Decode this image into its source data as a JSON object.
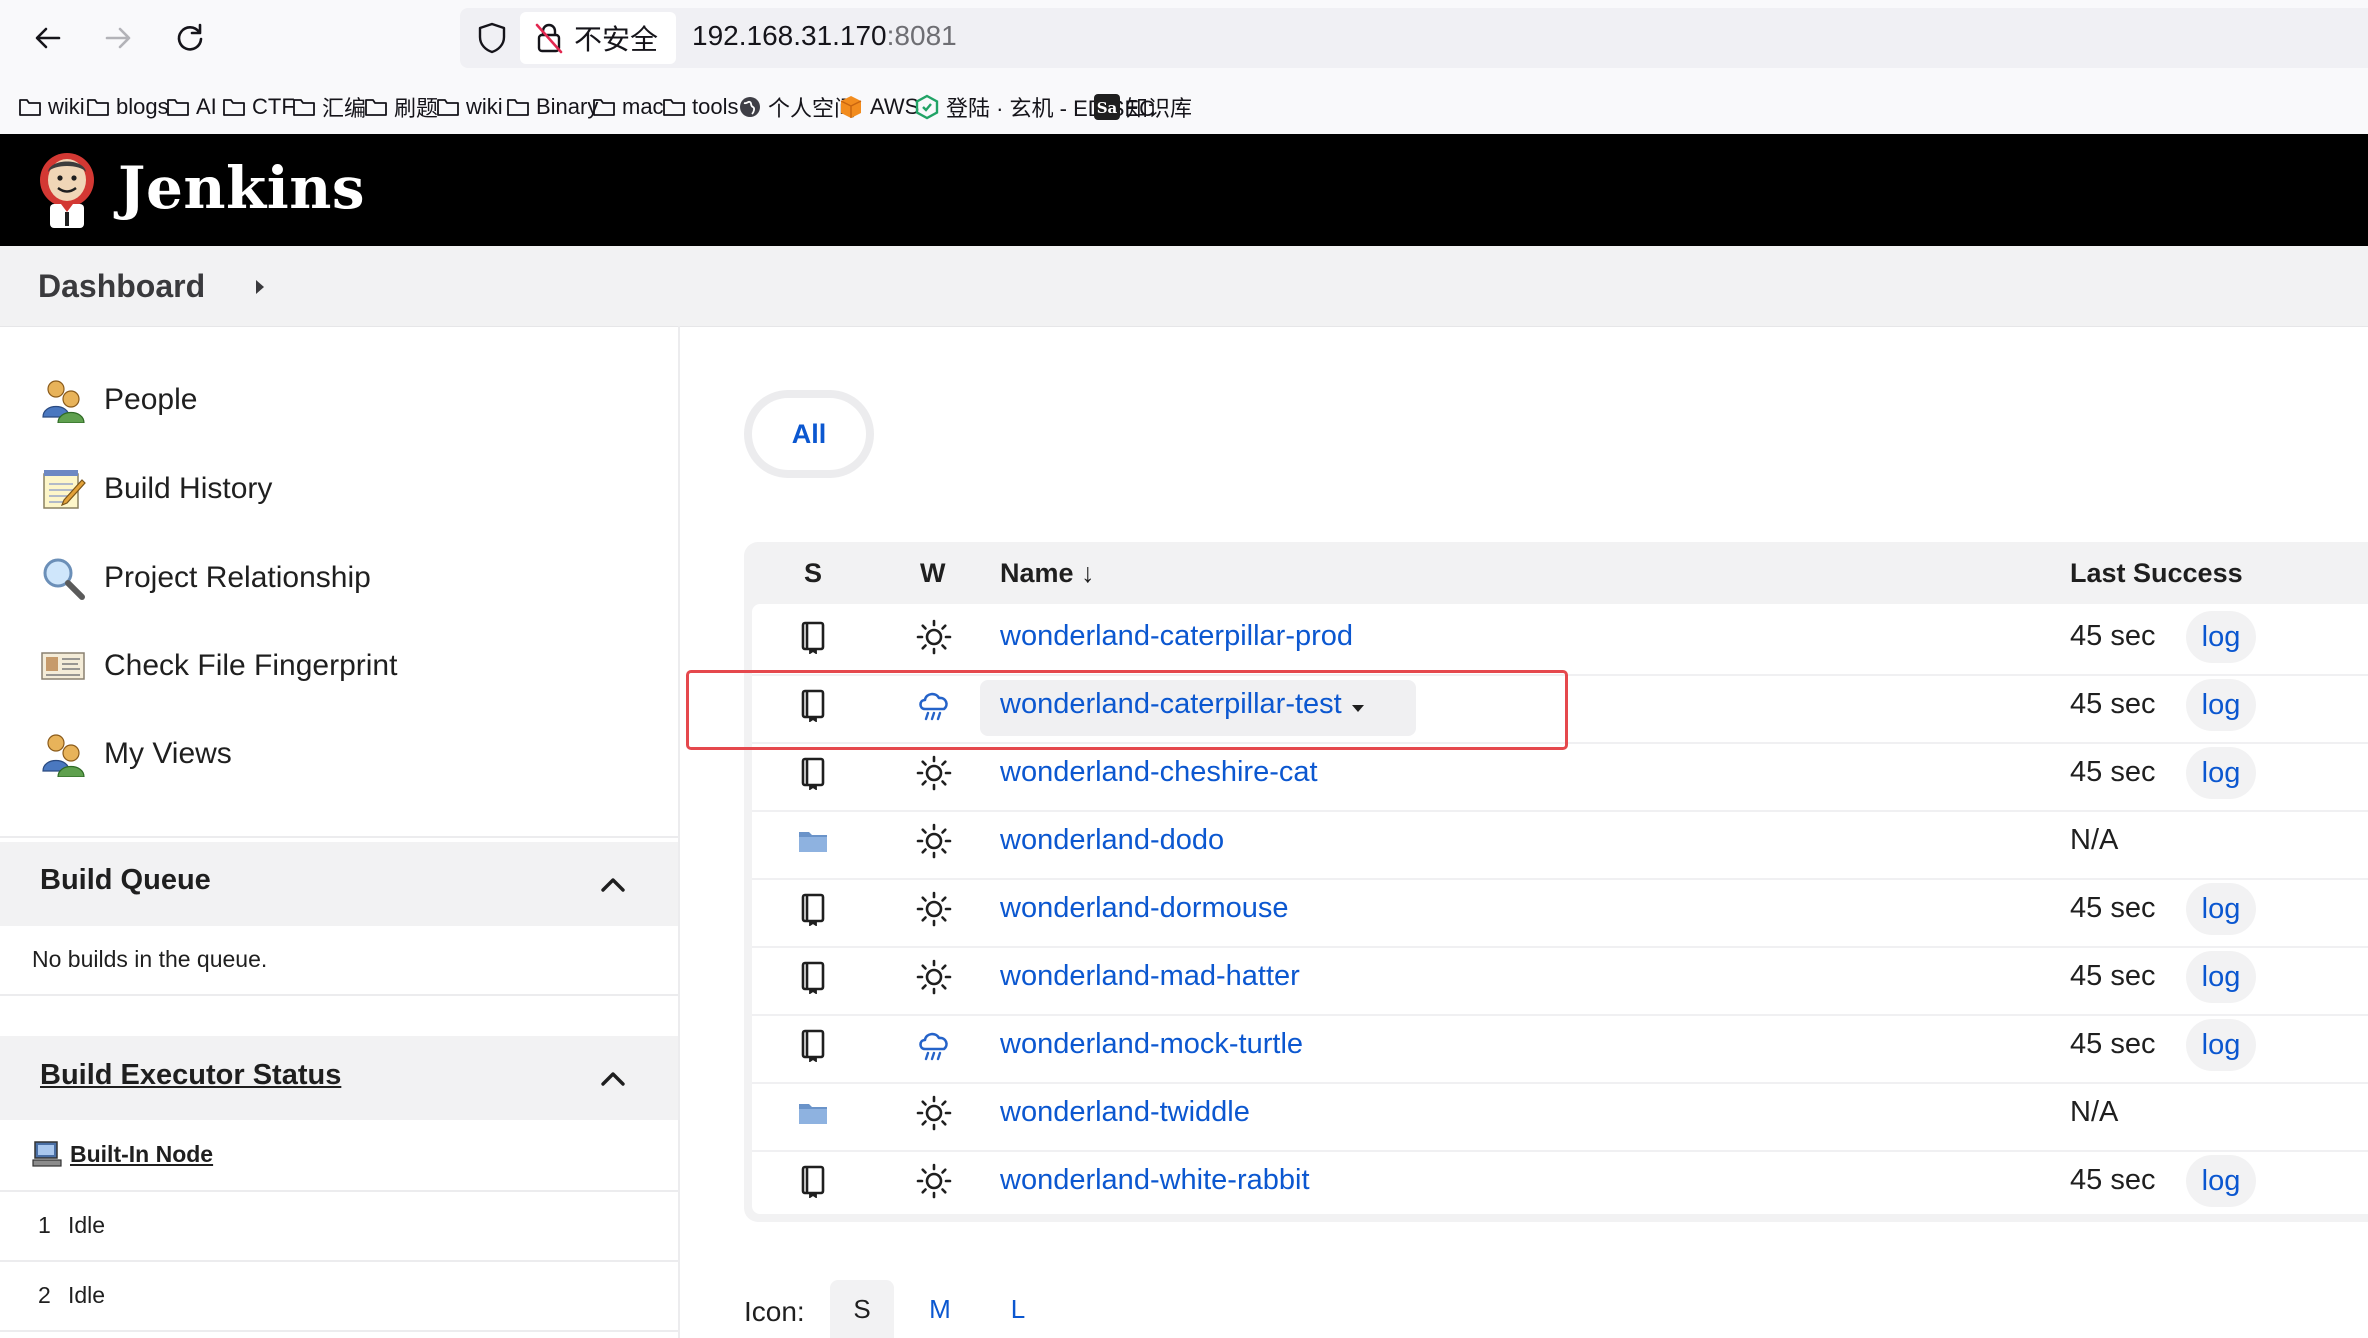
{
  "browser": {
    "insecure_label": "不安全",
    "url_host": "192.168.31.170",
    "url_port": ":8081",
    "bookmarks": [
      {
        "label": "wiki",
        "icon": "folder-icon"
      },
      {
        "label": "blogs",
        "icon": "folder-icon"
      },
      {
        "label": "AI",
        "icon": "folder-icon"
      },
      {
        "label": "CTF",
        "icon": "folder-icon"
      },
      {
        "label": "汇编",
        "icon": "folder-icon"
      },
      {
        "label": "刷题",
        "icon": "folder-icon"
      },
      {
        "label": "wiki",
        "icon": "folder-icon"
      },
      {
        "label": "Binary",
        "icon": "folder-icon"
      },
      {
        "label": "mac",
        "icon": "folder-icon"
      },
      {
        "label": "tools",
        "icon": "folder-icon"
      },
      {
        "label": "个人空间",
        "icon": "globe-icon"
      },
      {
        "label": "AWS",
        "icon": "aws-cube-icon"
      },
      {
        "label": "登陆 · 玄机 - EDISEC",
        "icon": "hexagon-logo-icon"
      },
      {
        "label": "知识库",
        "icon": "sa-logo-icon"
      }
    ]
  },
  "header": {
    "title": "Jenkins"
  },
  "breadcrumb": {
    "dashboard": "Dashboard"
  },
  "sidebar": {
    "items": [
      {
        "label": "People",
        "icon": "people-icon"
      },
      {
        "label": "Build History",
        "icon": "notepad-icon"
      },
      {
        "label": "Project Relationship",
        "icon": "magnifier-icon"
      },
      {
        "label": "Check File Fingerprint",
        "icon": "fingerprint-card-icon"
      },
      {
        "label": "My Views",
        "icon": "people-icon"
      }
    ],
    "build_queue": {
      "title": "Build Queue",
      "empty_text": "No builds in the queue."
    },
    "executor_status": {
      "title": "Build Executor Status",
      "node": "Built-In Node",
      "executors": [
        {
          "num": "1",
          "state": "Idle"
        },
        {
          "num": "2",
          "state": "Idle"
        }
      ]
    }
  },
  "main": {
    "tab_all": "All",
    "columns": {
      "s": "S",
      "w": "W",
      "name": "Name",
      "name_sort": "↓",
      "last_success": "Last Success"
    },
    "jobs": [
      {
        "name": "wonderland-caterpillar-prod",
        "status_icon": "notebook-icon",
        "weather_icon": "sunny-icon",
        "last_success": "45 sec",
        "log": "log"
      },
      {
        "name": "wonderland-caterpillar-test",
        "status_icon": "notebook-icon",
        "weather_icon": "rain-cloud-icon",
        "last_success": "45 sec",
        "log": "log"
      },
      {
        "name": "wonderland-cheshire-cat",
        "status_icon": "notebook-icon",
        "weather_icon": "sunny-icon",
        "last_success": "45 sec",
        "log": "log"
      },
      {
        "name": "wonderland-dodo",
        "status_icon": "folder-icon",
        "weather_icon": "sunny-icon",
        "last_success": "N/A",
        "log": ""
      },
      {
        "name": "wonderland-dormouse",
        "status_icon": "notebook-icon",
        "weather_icon": "sunny-icon",
        "last_success": "45 sec",
        "log": "log"
      },
      {
        "name": "wonderland-mad-hatter",
        "status_icon": "notebook-icon",
        "weather_icon": "sunny-icon",
        "last_success": "45 sec",
        "log": "log"
      },
      {
        "name": "wonderland-mock-turtle",
        "status_icon": "notebook-icon",
        "weather_icon": "rain-cloud-icon",
        "last_success": "45 sec",
        "log": "log"
      },
      {
        "name": "wonderland-twiddle",
        "status_icon": "folder-icon",
        "weather_icon": "sunny-icon",
        "last_success": "N/A",
        "log": ""
      },
      {
        "name": "wonderland-white-rabbit",
        "status_icon": "notebook-icon",
        "weather_icon": "sunny-icon",
        "last_success": "45 sec",
        "log": "log"
      }
    ],
    "icon_size": {
      "label": "Icon:",
      "options": [
        "S",
        "M",
        "L"
      ],
      "selected": "S"
    },
    "colors": {
      "link": "#0b57d0",
      "highlight": "#e5484d"
    }
  }
}
